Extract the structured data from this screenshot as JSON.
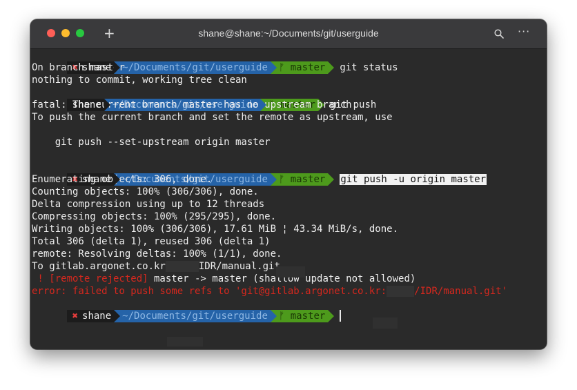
{
  "window": {
    "title": "shane@shane:~/Documents/git/userguide",
    "new_tab_glyph": "+",
    "more_glyph": "···"
  },
  "prompt": {
    "error_mark": "✖",
    "user": "shane",
    "dir": "~/Documents/git/userguide",
    "branch_icon": "ᚠ",
    "branch": "master"
  },
  "commands": {
    "c1": "git status",
    "c2": "git push",
    "c3": "git push -u origin master"
  },
  "output": {
    "o1": "On branch master",
    "o2": "nothing to commit, working tree clean",
    "o3": "fatal: The current branch master has no upstream branch.",
    "o4": "To push the current branch and set the remote as upstream, use",
    "o5": "    git push --set-upstream origin master",
    "o6": "Enumerating objects: 306, done.",
    "o7": "Counting objects: 100% (306/306), done.",
    "o8": "Delta compression using up to 12 threads",
    "o9": "Compressing objects: 100% (295/295), done.",
    "o10": "Writing objects: 100% (306/306), 17.61 MiB ¦ 43.34 MiB/s, done.",
    "o11": "Total 306 (delta 1), reused 306 (delta 1)",
    "o12": "remote: Resolving deltas: 100% (1/1), done.",
    "o13a": "To gitlab.argonet.co.kr",
    "o13b": "IDR/manual.git",
    "o14a": " ! [remote rejected]",
    "o14b": " master -> master (shallow update not allowed)",
    "o15a": "error: failed to push some refs to 'git@gitlab.argonet.co.kr:",
    "o15b": "/IDR/manual.git'"
  },
  "colors": {
    "background": "#2a2a2a",
    "prompt_dir": "#2563a8",
    "prompt_git": "#4d9a1c",
    "error": "#d6281e"
  },
  "icons": [
    "close-light",
    "minimize-light",
    "zoom-light",
    "new-tab-icon",
    "search-icon",
    "more-icon",
    "branch-icon",
    "error-x-icon"
  ]
}
